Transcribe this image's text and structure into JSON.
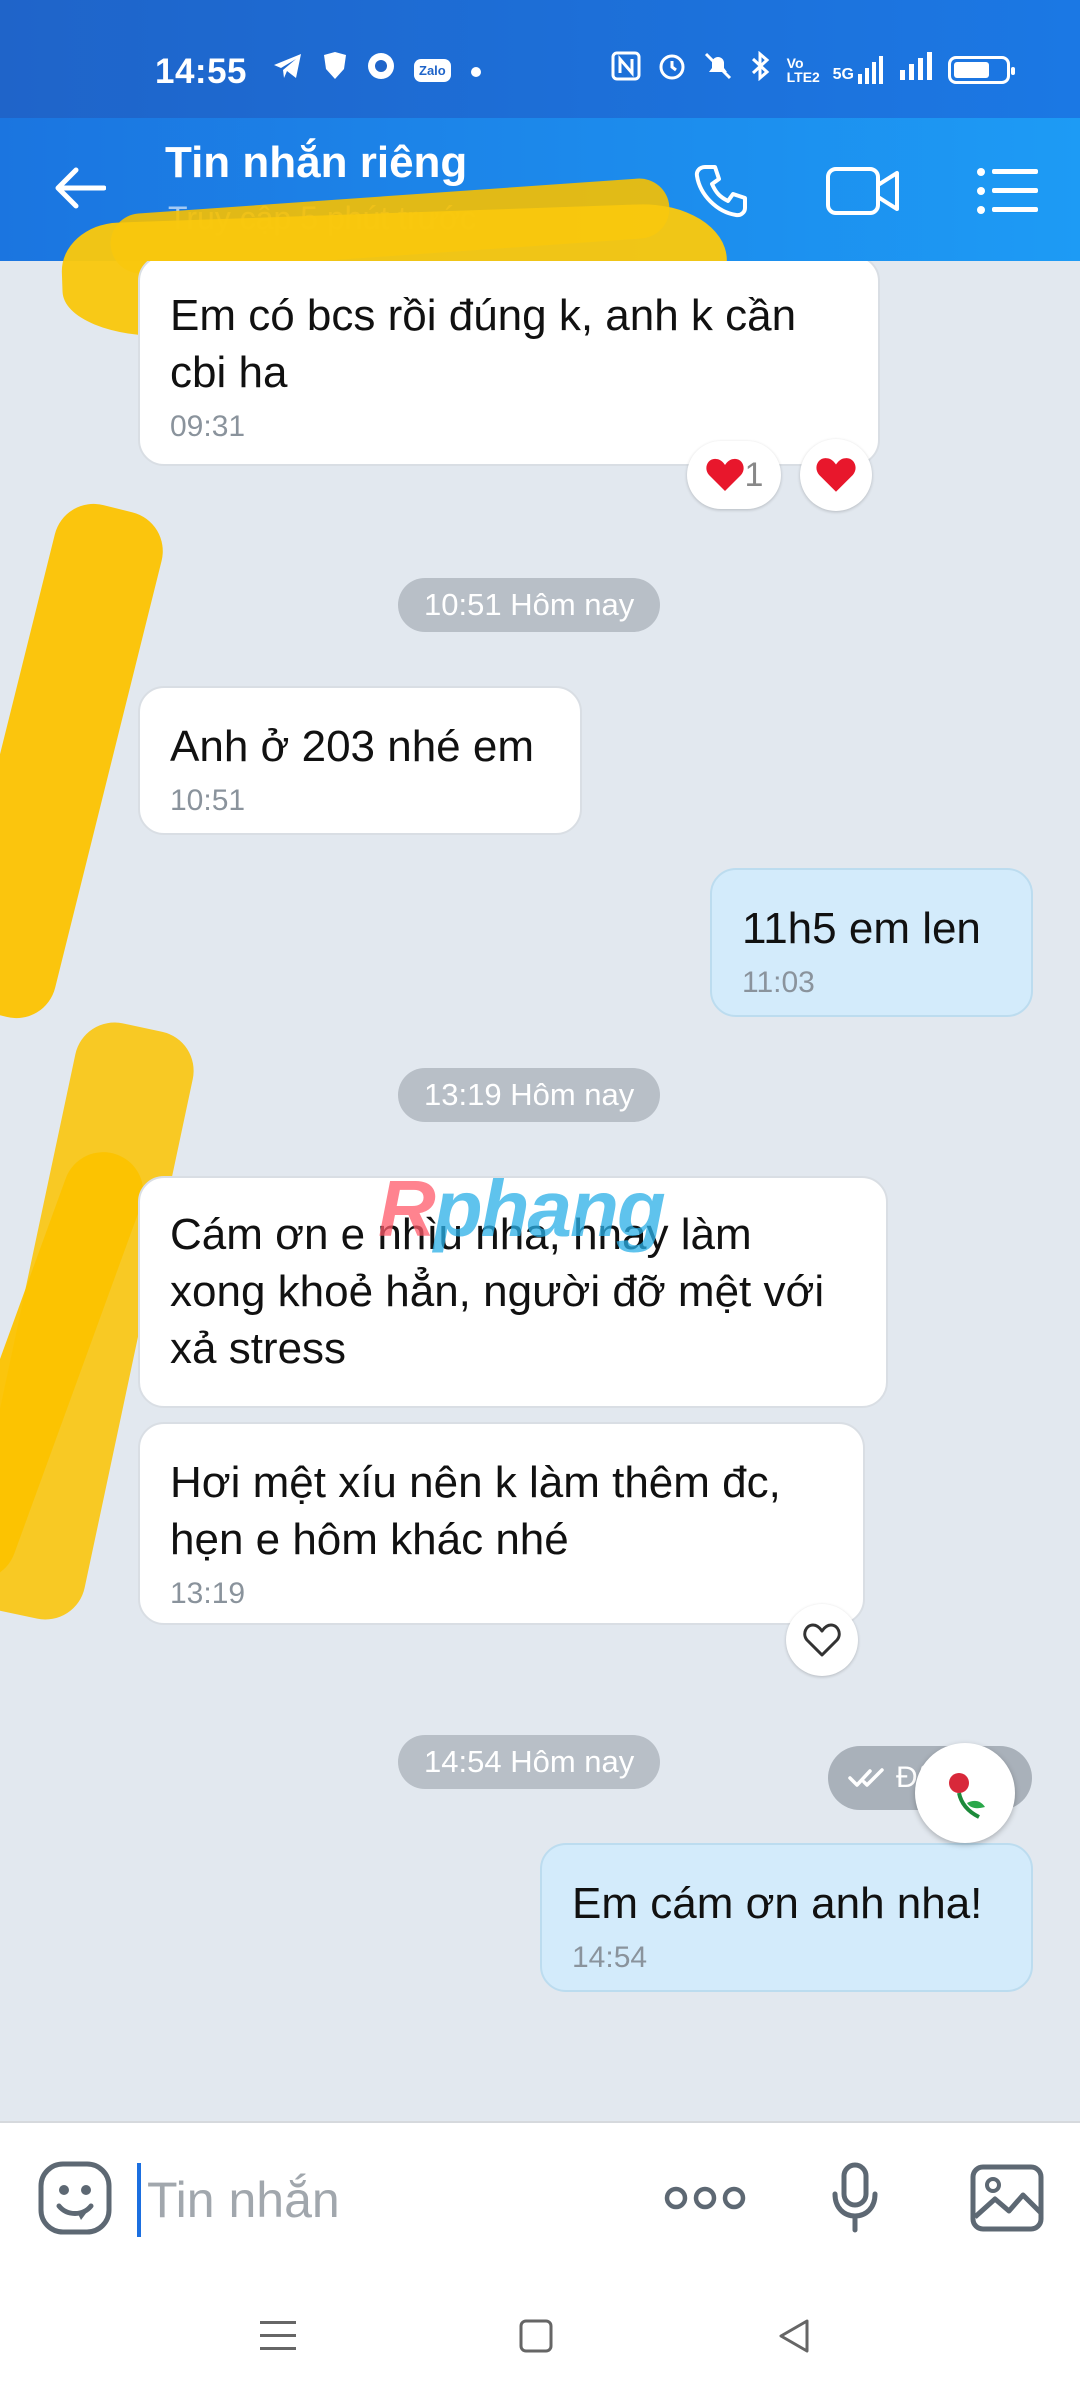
{
  "status_bar": {
    "time": "14:55",
    "notification_icons": [
      "telegram-icon",
      "vpn-shield-icon",
      "app-icon",
      "zalo-icon",
      "dot-icon"
    ],
    "zalo_badge": "Zalo",
    "system_icons": [
      "nfc-icon",
      "alarm-icon",
      "mute-icon",
      "bluetooth-icon",
      "volte-icon",
      "5g-signal-icon",
      "signal-icon",
      "battery-icon"
    ],
    "volte": "Vo LTE2",
    "network": "5G"
  },
  "header": {
    "contact_name": "Tin nhắn riêng",
    "last_seen": "Truy cập 5 phút trước",
    "accent_color": "#1b78e4"
  },
  "messages": [
    {
      "id": "m1",
      "direction": "in",
      "text_lines": [
        "Em có bcs rồi đúng k, anh k cần",
        "cbi ha"
      ],
      "time": "09:31"
    },
    {
      "id": "m2",
      "direction": "in",
      "text_lines": [
        "Anh ở 203 nhé em"
      ],
      "time": "10:51"
    },
    {
      "id": "m3",
      "direction": "out",
      "text_lines": [
        "11h5 em len"
      ],
      "time": "11:03"
    },
    {
      "id": "m4",
      "direction": "in",
      "text_lines": [
        "Cám ơn e nhìu nha, hnay làm",
        "xong khoẻ hẳn, người đỡ mệt với",
        "xả stress"
      ],
      "time": ""
    },
    {
      "id": "m5",
      "direction": "in",
      "text_lines": [
        "Hơi mệt xíu nên k làm thêm đc,",
        "hẹn e hôm khác nhé"
      ],
      "time": "13:19"
    },
    {
      "id": "m6",
      "direction": "out",
      "text_lines": [
        "Em cám ơn anh nha!"
      ],
      "time": "14:54"
    }
  ],
  "date_separators": [
    "10:51 Hôm nay",
    "13:19 Hôm nay",
    "14:54 Hôm nay"
  ],
  "reactions": {
    "m1_count": "1",
    "heart_color": "#e8172c"
  },
  "seen_label": "Đã nhận",
  "watermark": {
    "part1": "R",
    "part2": "phang"
  },
  "input": {
    "placeholder": "Tin nhắn"
  },
  "icons": {
    "emoji": "emoji-icon",
    "more": "more-icon",
    "mic": "microphone-icon",
    "image": "image-icon",
    "call": "phone-icon",
    "video": "video-call-icon",
    "menu": "menu-icon",
    "back": "back-arrow-icon"
  }
}
